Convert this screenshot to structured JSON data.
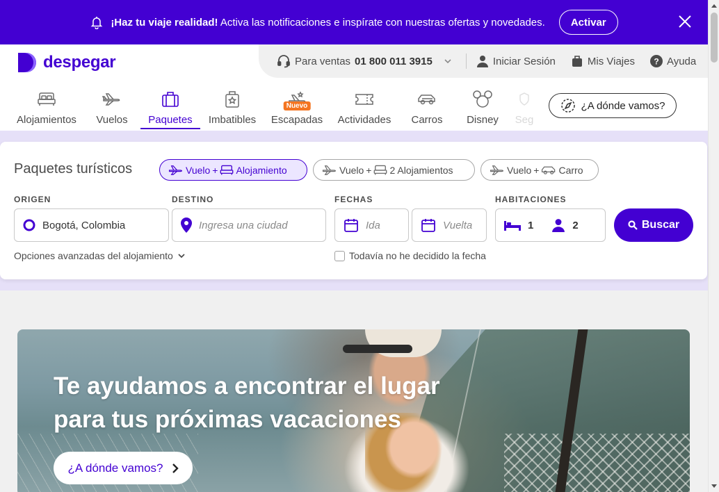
{
  "notification": {
    "bold_text": "¡Haz tu viaje realidad!",
    "text": " Activa las notificaciones e inspírate con nuestras ofertas y novedades.",
    "activate_label": "Activar"
  },
  "brand": {
    "name": "despegar",
    "color": "#4300d2"
  },
  "topbar": {
    "sales_label": "Para ventas",
    "sales_phone": "01 800 011 3915",
    "login_label": "Iniciar Sesión",
    "trips_label": "Mis Viajes",
    "help_label": "Ayuda"
  },
  "nav": {
    "tabs": [
      {
        "label": "Alojamientos",
        "icon": "bed-icon"
      },
      {
        "label": "Vuelos",
        "icon": "plane-icon"
      },
      {
        "label": "Paquetes",
        "icon": "suitcase-icon",
        "active": true
      },
      {
        "label": "Imbatibles",
        "icon": "luggage-star-icon"
      },
      {
        "label": "Escapadas",
        "icon": "plane-star-icon",
        "badge": "Nuevo"
      },
      {
        "label": "Actividades",
        "icon": "ticket-icon"
      },
      {
        "label": "Carros",
        "icon": "car-icon"
      },
      {
        "label": "Disney",
        "icon": "mickey-icon"
      },
      {
        "label": "Seg",
        "icon": "insurance-icon"
      }
    ],
    "where_label": "¿A dónde vamos?"
  },
  "search": {
    "title": "Paquetes turísticos",
    "chips": [
      {
        "part1": "Vuelo",
        "plus": "+",
        "part2": "Alojamiento",
        "active": true
      },
      {
        "part1": "Vuelo",
        "plus": "+",
        "part2": "2 Alojamientos",
        "active": false
      },
      {
        "part1": "Vuelo",
        "plus": "+",
        "part2": "Carro",
        "active": false
      }
    ],
    "labels": {
      "origin": "ORIGEN",
      "destination": "DESTINO",
      "dates": "FECHAS",
      "rooms": "HABITACIONES"
    },
    "origin_value": "Bogotá, Colombia",
    "destination_placeholder": "Ingresa una ciudad",
    "date_from_placeholder": "Ida",
    "date_to_placeholder": "Vuelta",
    "rooms_count": "1",
    "people_count": "2",
    "search_label": "Buscar",
    "advanced_label": "Opciones avanzadas del alojamiento",
    "undecided_label": "Todavía no he decidido la fecha"
  },
  "hero": {
    "headline_line1": "Te ayudamos a encontrar el lugar",
    "headline_line2": "para tus próximas vacaciones",
    "cta_label": "¿A dónde vamos?"
  }
}
